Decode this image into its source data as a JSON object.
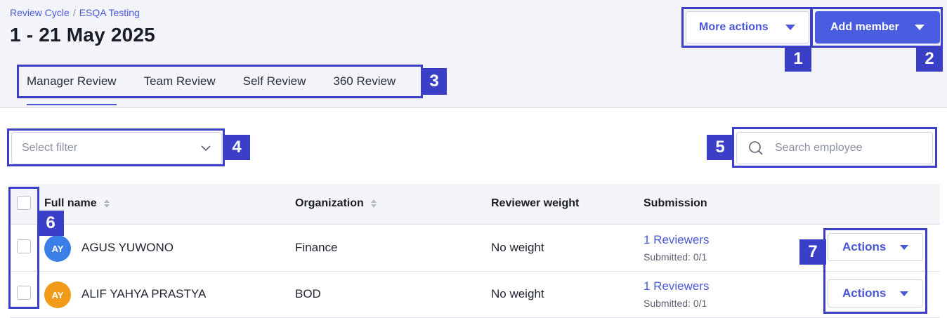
{
  "breadcrumb": {
    "parent": "Review Cycle",
    "separator": "/",
    "current": "ESQA Testing"
  },
  "page_title": "1 - 21 May 2025",
  "header_actions": {
    "more_actions": "More actions",
    "add_member": "Add member"
  },
  "tabs": [
    {
      "label": "Manager Review",
      "active": true
    },
    {
      "label": "Team Review"
    },
    {
      "label": "Self Review"
    },
    {
      "label": "360 Review"
    }
  ],
  "filter": {
    "placeholder": "Select filter"
  },
  "search": {
    "placeholder": "Search employee"
  },
  "table": {
    "columns": {
      "full_name": "Full name",
      "organization": "Organization",
      "reviewer_weight": "Reviewer weight",
      "submission": "Submission"
    },
    "rows": [
      {
        "initials": "AY",
        "avatar_color": "#3b7ee8",
        "name": "AGUS YUWONO",
        "organization": "Finance",
        "weight": "No weight",
        "reviewers": "1 Reviewers",
        "submitted": "Submitted: 0/1",
        "action": "Actions"
      },
      {
        "initials": "AY",
        "avatar_color": "#f29a1a",
        "name": "ALIF YAHYA PRASTYA",
        "organization": "BOD",
        "weight": "No weight",
        "reviewers": "1 Reviewers",
        "submitted": "Submitted: 0/1",
        "action": "Actions"
      }
    ]
  },
  "annotations": [
    "1",
    "2",
    "3",
    "4",
    "5",
    "6",
    "7"
  ],
  "colors": {
    "accent": "#4a58d6",
    "primary_button": "#4a5ce0",
    "annotation": "#3b3fc8",
    "header_bg": "#f2f4f9"
  }
}
